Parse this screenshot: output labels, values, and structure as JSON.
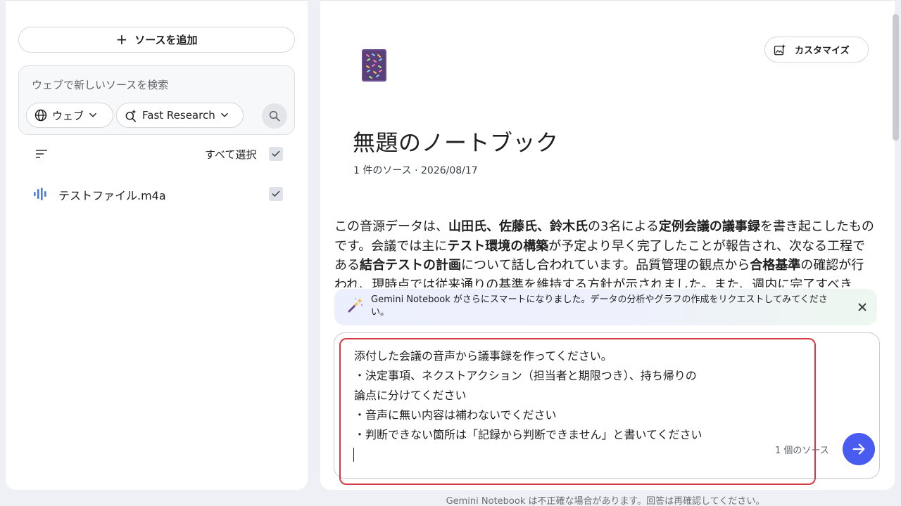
{
  "sources_panel": {
    "add_source_label": "ソースを追加",
    "web_search": {
      "placeholder": "ウェブで新しいソースを検索",
      "source_type_label": "ウェブ",
      "mode_label": "Fast Research"
    },
    "select_all_label": "すべて選択",
    "select_all_checked": true,
    "files": [
      {
        "name": "テストファイル.m4a",
        "icon": "audio-icon",
        "checked": true
      }
    ]
  },
  "notebook": {
    "customize_label": "カスタマイズ",
    "emoji": "📔",
    "title": "無題のノートブック",
    "meta": "1 件のソース · 2026/08/17",
    "summary": [
      {
        "t": "この音源データは、"
      },
      {
        "t": "山田氏、佐藤氏、鈴木氏",
        "b": true
      },
      {
        "t": "の3名による"
      },
      {
        "t": "定例会議の議事録",
        "b": true
      },
      {
        "t": "を書き起こしたものです。会議では主に"
      },
      {
        "t": "テスト環境の構築",
        "b": true
      },
      {
        "t": "が予定より早く完了したことが報告され、次なる工程である"
      },
      {
        "t": "結合テストの計画",
        "b": true
      },
      {
        "t": "について話し合われています。品質管理の観点から"
      },
      {
        "t": "合格基準",
        "b": true
      },
      {
        "t": "の確認が行われ、現時点では従来通りの基準を維持する方針が示されました。また、週内に完了すべき"
      }
    ]
  },
  "banner": {
    "text": "Gemini Notebook がさらにスマートになりました。データの分析やグラフの作成をリクエストしてみてください。"
  },
  "chat": {
    "input_value": "添付した会議の音声から議事録を作ってください。\n・決定事項、ネクストアクション（担当者と期限つき）、持ち帰りの\n論点に分けてください\n・音声に無い内容は補わないでください\n・判断できない箇所は「記録から判断できません」と書いてください",
    "source_count": "1 個のソース"
  },
  "footer": {
    "disclaimer": "Gemini Notebook は不正確な場合があります。回答は再確認してください。"
  },
  "colors": {
    "accent": "#4a5cf0",
    "highlight": "#d33a42",
    "audio_icon": "#4a7be0"
  }
}
